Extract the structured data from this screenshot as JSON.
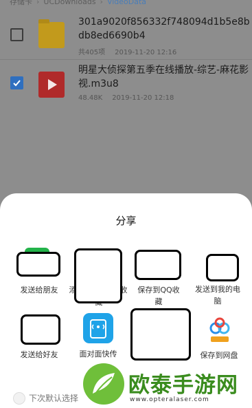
{
  "breadcrumb": {
    "items": [
      "存储卡",
      "UCDownloads",
      "VideoData"
    ]
  },
  "files": [
    {
      "name": "301a9020f856332f748094d1b5e8bdb8ed6690b4",
      "size": "共405项",
      "date": "2019-11-20 12:16",
      "icon": "folder-icon",
      "checked": false
    },
    {
      "name": "明星大侦探第五季在线播放-综艺-麻花影视.m3u8",
      "size": "48.48K",
      "date": "2019-11-20 12:18",
      "icon": "video-file-icon",
      "checked": true
    }
  ],
  "share_sheet": {
    "title": "分享",
    "targets": [
      {
        "label": "发送给朋友",
        "icon": "wechat-icon"
      },
      {
        "label": "添",
        "icon": "unknown-icon"
      },
      {
        "label": "藏",
        "icon": "unknown-icon"
      },
      {
        "label": "保存到QQ收",
        "label2": "藏",
        "icon": "qq-favorites-icon"
      },
      {
        "label": "发送到我的电",
        "label2": "脑",
        "icon": "qq-computer-icon"
      },
      {
        "label": "发送给好友",
        "icon": "qq-icon"
      },
      {
        "label": "面对面快传",
        "icon": "face-to-face-transfer-icon"
      },
      {
        "label": "保存到网盘",
        "icon": "baidu-netdisk-icon"
      }
    ],
    "default_option": "下次默认选择"
  },
  "watermark": {
    "text": "欧泰手游网",
    "url": "www.opteralaser.com"
  },
  "colors": {
    "accent": "#2f6fbf",
    "folder": "#c29a1c",
    "video_file": "#b02a2a",
    "transfer_icon": "#1fa3e8",
    "watermark_green": "#3a8c1e"
  }
}
